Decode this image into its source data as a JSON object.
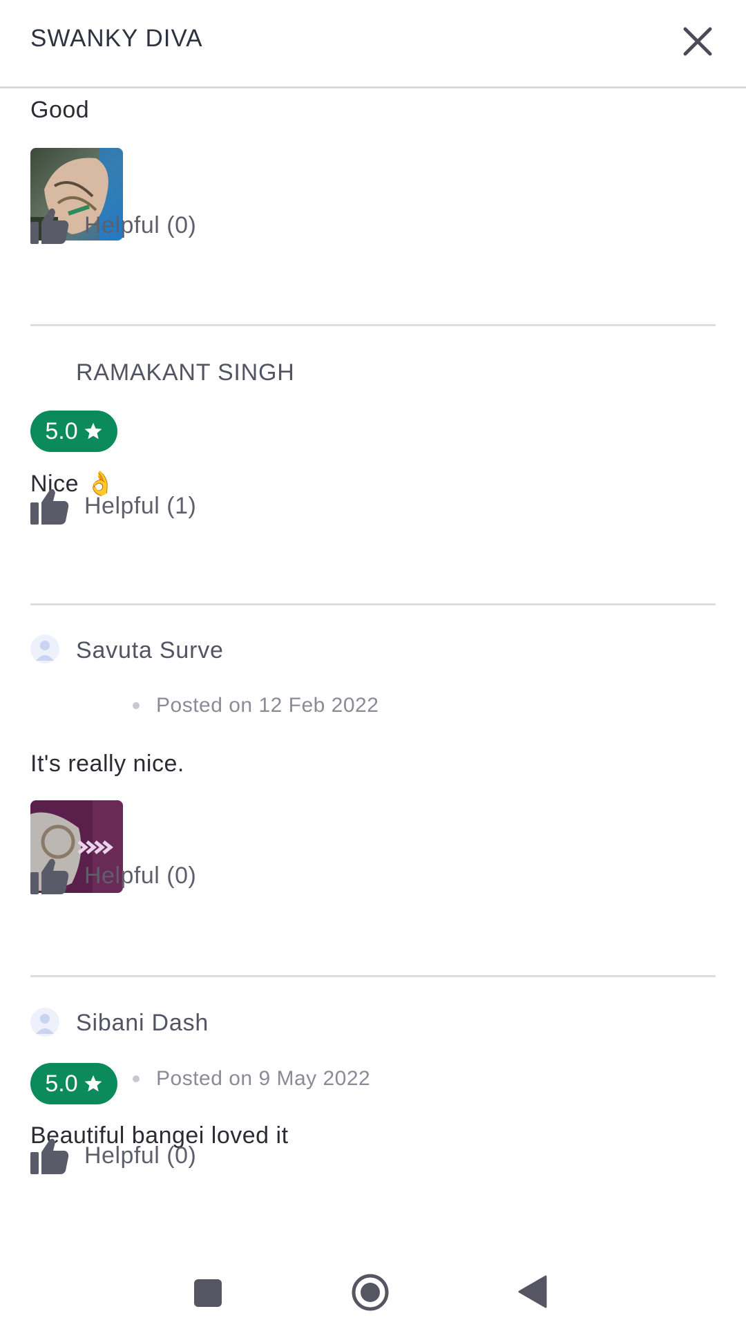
{
  "header": {
    "title": "SWANKY DIVA",
    "close_icon": "close-icon"
  },
  "reviews": [
    {
      "text": "Good",
      "has_photo": true,
      "helpful_label": "Helpful (0)"
    },
    {
      "author": "RAMAKANT SINGH",
      "rating": "5.0",
      "text": "Nice 👌",
      "helpful_label": "Helpful (1)"
    },
    {
      "author": "Savuta Surve",
      "posted": "Posted on 12 Feb 2022",
      "text": "It's really nice.",
      "has_photo": true,
      "helpful_label": "Helpful (0)"
    },
    {
      "author": "Sibani Dash",
      "rating": "5.0",
      "posted": "Posted on 9 May 2022",
      "text": "Beautiful bangei loved it",
      "helpful_label": "Helpful (0)"
    }
  ],
  "colors": {
    "rating_badge": "#0b8a5b",
    "text": "#2b2b33",
    "muted": "#8a8b96",
    "divider": "#dcdce1",
    "icon": "#5a5b68"
  },
  "navbar": {
    "recents_icon": "square-icon",
    "home_icon": "home-circle-icon",
    "back_icon": "back-triangle-icon"
  }
}
